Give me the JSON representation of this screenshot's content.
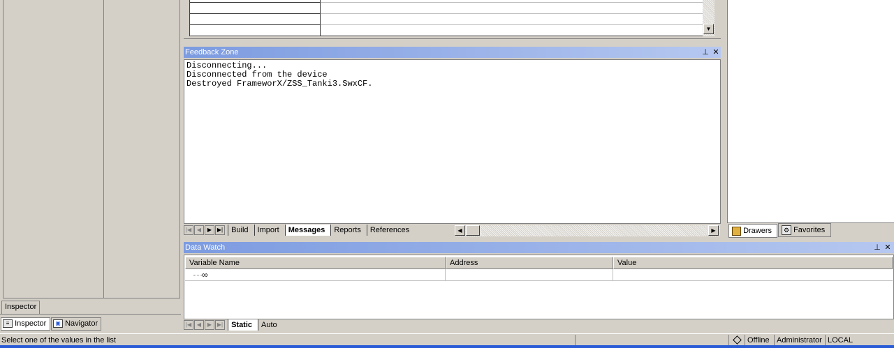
{
  "left_panel": {
    "active_tab": "Inspector",
    "bottom_tabs": [
      {
        "label": "Inspector",
        "icon": "inspector-icon"
      },
      {
        "label": "Navigator",
        "icon": "navigator-icon"
      }
    ]
  },
  "feedback": {
    "title": "Feedback Zone",
    "lines": [
      "Disconnecting...",
      "Disconnected from the device",
      "Destroyed FrameworX/ZSS_Tanki3.SwxCF."
    ],
    "tabs": [
      "Build",
      "Import",
      "Messages",
      "Reports",
      "References"
    ],
    "active_tab": "Messages"
  },
  "right_panel": {
    "tabs": [
      {
        "label": "Drawers",
        "icon": "drawers-icon"
      },
      {
        "label": "Favorites",
        "icon": "favorites-icon"
      }
    ]
  },
  "datawatch": {
    "title": "Data Watch",
    "columns": [
      "Variable Name",
      "Address",
      "Value"
    ],
    "tabs": [
      "Static",
      "Auto"
    ],
    "active_tab": "Static"
  },
  "statusbar": {
    "message": "Select one of the values in the list",
    "state": "Offline",
    "user": "Administrator",
    "location": "LOCAL"
  }
}
